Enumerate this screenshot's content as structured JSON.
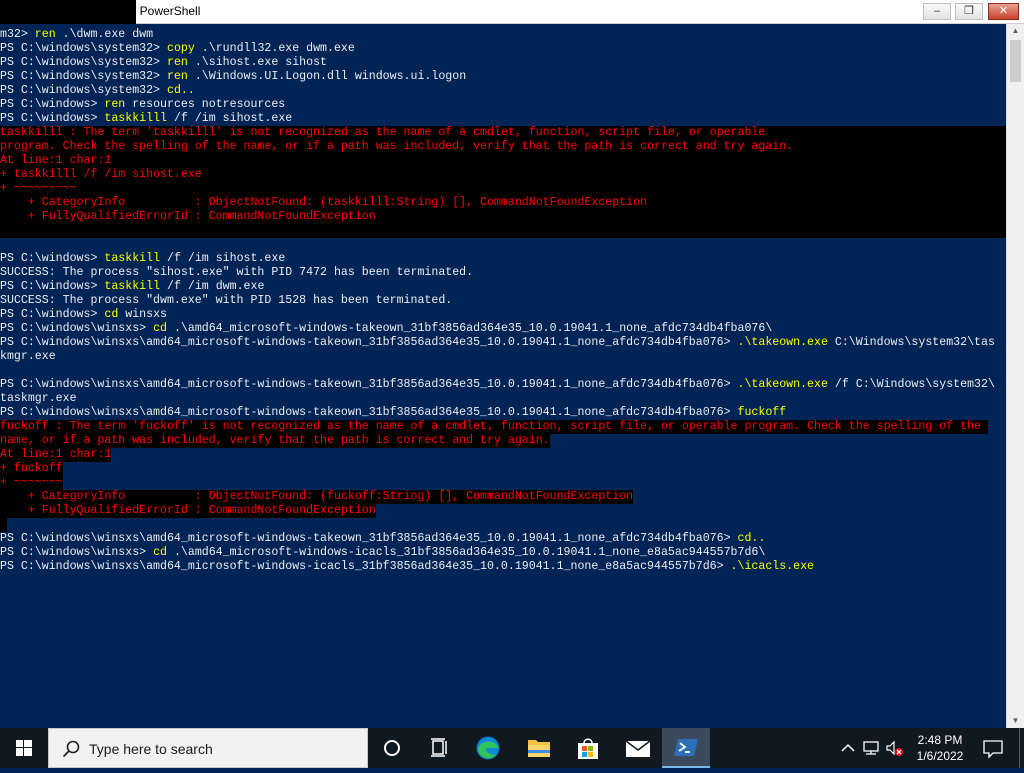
{
  "window": {
    "title": "ows PowerShell",
    "min_glyph": "‒",
    "max_glyph": "❐",
    "close_glyph": "✕"
  },
  "colors": {
    "console_bg": "#012456",
    "console_fg": "#eeedf0",
    "command_fg": "#ffff00",
    "error_fg": "#ff0000",
    "error_bg": "#000000"
  },
  "console": {
    "lines": [
      {
        "type": "mixed",
        "parts": [
          {
            "t": "m32> "
          },
          {
            "t": "ren",
            "c": 1
          },
          {
            "t": " .\\dwm.exe dwm"
          }
        ]
      },
      {
        "type": "mixed",
        "parts": [
          {
            "t": "PS C:\\windows\\system32> "
          },
          {
            "t": "copy",
            "c": 1
          },
          {
            "t": " .\\rundll32.exe dwm.exe"
          }
        ]
      },
      {
        "type": "mixed",
        "parts": [
          {
            "t": "PS C:\\windows\\system32> "
          },
          {
            "t": "ren",
            "c": 1
          },
          {
            "t": " .\\sihost.exe sihost"
          }
        ]
      },
      {
        "type": "mixed",
        "parts": [
          {
            "t": "PS C:\\windows\\system32> "
          },
          {
            "t": "ren",
            "c": 1
          },
          {
            "t": " .\\Windows.UI.Logon.dll windows.ui.logon"
          }
        ]
      },
      {
        "type": "mixed",
        "parts": [
          {
            "t": "PS C:\\windows\\system32> "
          },
          {
            "t": "cd..",
            "c": 1
          }
        ]
      },
      {
        "type": "mixed",
        "parts": [
          {
            "t": "PS C:\\windows> "
          },
          {
            "t": "ren",
            "c": 1
          },
          {
            "t": " resources notresources"
          }
        ]
      },
      {
        "type": "mixed",
        "parts": [
          {
            "t": "PS C:\\windows> "
          },
          {
            "t": "taskkilll",
            "c": 1
          },
          {
            "t": " /f /im sihost.exe"
          }
        ]
      },
      {
        "type": "err",
        "full": true,
        "text": "taskkilll : The term 'taskkilll' is not recognized as the name of a cmdlet, function, script file, or operable"
      },
      {
        "type": "err",
        "full": true,
        "text": "program. Check the spelling of the name, or if a path was included, verify that the path is correct and try again."
      },
      {
        "type": "err",
        "full": true,
        "text": "At line:1 char:1"
      },
      {
        "type": "err",
        "full": true,
        "text": "+ taskkilll /f /im sihost.exe"
      },
      {
        "type": "err",
        "full": true,
        "text": "+ ~~~~~~~~~"
      },
      {
        "type": "err",
        "full": true,
        "text": "    + CategoryInfo          : ObjectNotFound: (taskkilll:String) [], CommandNotFoundException"
      },
      {
        "type": "err",
        "full": true,
        "text": "    + FullyQualifiedErrorId : CommandNotFoundException"
      },
      {
        "type": "err",
        "full": true,
        "text": " "
      },
      {
        "type": "blank",
        "text": ""
      },
      {
        "type": "mixed",
        "parts": [
          {
            "t": "PS C:\\windows> "
          },
          {
            "t": "taskkill",
            "c": 1
          },
          {
            "t": " /f /im sihost.exe"
          }
        ]
      },
      {
        "type": "plain",
        "text": "SUCCESS: The process \"sihost.exe\" with PID 7472 has been terminated."
      },
      {
        "type": "mixed",
        "parts": [
          {
            "t": "PS C:\\windows> "
          },
          {
            "t": "taskkill",
            "c": 1
          },
          {
            "t": " /f /im dwm.exe"
          }
        ]
      },
      {
        "type": "plain",
        "text": "SUCCESS: The process \"dwm.exe\" with PID 1528 has been terminated."
      },
      {
        "type": "mixed",
        "parts": [
          {
            "t": "PS C:\\windows> "
          },
          {
            "t": "cd",
            "c": 1
          },
          {
            "t": " winsxs"
          }
        ]
      },
      {
        "type": "mixed",
        "parts": [
          {
            "t": "PS C:\\windows\\winsxs> "
          },
          {
            "t": "cd",
            "c": 1
          },
          {
            "t": " .\\amd64_microsoft-windows-takeown_31bf3856ad364e35_10.0.19041.1_none_afdc734db4fba076\\"
          }
        ]
      },
      {
        "type": "mixed",
        "parts": [
          {
            "t": "PS C:\\windows\\winsxs\\amd64_microsoft-windows-takeown_31bf3856ad364e35_10.0.19041.1_none_afdc734db4fba076> "
          },
          {
            "t": ".\\takeown.exe",
            "c": 1
          },
          {
            "t": " C:\\Windows\\system32\\tas"
          }
        ]
      },
      {
        "type": "plain",
        "text": "kmgr.exe"
      },
      {
        "type": "blank",
        "text": ""
      },
      {
        "type": "mixed",
        "parts": [
          {
            "t": "PS C:\\windows\\winsxs\\amd64_microsoft-windows-takeown_31bf3856ad364e35_10.0.19041.1_none_afdc734db4fba076> "
          },
          {
            "t": ".\\takeown.exe",
            "c": 1
          },
          {
            "t": " /f C:\\Windows\\system32\\"
          }
        ]
      },
      {
        "type": "plain",
        "text": "taskmgr.exe"
      },
      {
        "type": "mixed",
        "parts": [
          {
            "t": "PS C:\\windows\\winsxs\\amd64_microsoft-windows-takeown_31bf3856ad364e35_10.0.19041.1_none_afdc734db4fba076> "
          },
          {
            "t": "fuckoff",
            "c": 1
          }
        ]
      },
      {
        "type": "err",
        "full": false,
        "text": "fuckoff : The term 'fuckoff' is not recognized as the name of a cmdlet, function, script file, or operable program. Check the spelling of the "
      },
      {
        "type": "err",
        "full": false,
        "text": "name, or if a path was included, verify that the path is correct and try again."
      },
      {
        "type": "err",
        "full": false,
        "text": "At line:1 char:1"
      },
      {
        "type": "err",
        "full": false,
        "text": "+ fuckoff"
      },
      {
        "type": "err",
        "full": false,
        "text": "+ ~~~~~~~"
      },
      {
        "type": "err",
        "full": false,
        "text": "    + CategoryInfo          : ObjectNotFound: (fuckoff:String) [], CommandNotFoundException"
      },
      {
        "type": "err",
        "full": false,
        "text": "    + FullyQualifiedErrorId : CommandNotFoundException"
      },
      {
        "type": "err",
        "full": false,
        "text": " "
      },
      {
        "type": "mixed",
        "parts": [
          {
            "t": "PS C:\\windows\\winsxs\\amd64_microsoft-windows-takeown_31bf3856ad364e35_10.0.19041.1_none_afdc734db4fba076> "
          },
          {
            "t": "cd..",
            "c": 1
          }
        ]
      },
      {
        "type": "mixed",
        "parts": [
          {
            "t": "PS C:\\windows\\winsxs> "
          },
          {
            "t": "cd",
            "c": 1
          },
          {
            "t": " .\\amd64_microsoft-windows-icacls_31bf3856ad364e35_10.0.19041.1_none_e8a5ac944557b7d6\\"
          }
        ]
      },
      {
        "type": "mixed",
        "parts": [
          {
            "t": "PS C:\\windows\\winsxs\\amd64_microsoft-windows-icacls_31bf3856ad364e35_10.0.19041.1_none_e8a5ac944557b7d6> "
          },
          {
            "t": ".\\icacls.exe",
            "c": 1
          }
        ]
      }
    ]
  },
  "taskbar": {
    "search_placeholder": "Type here to search",
    "time": "2:48 PM",
    "date": "1/6/2022",
    "icons": [
      "windows-start-icon",
      "search-icon",
      "cortana-icon",
      "task-view-icon",
      "edge-icon",
      "file-explorer-icon",
      "store-icon",
      "mail-icon",
      "powershell-icon"
    ],
    "tray_icons": [
      "chevron-up-icon",
      "network-icon",
      "volume-muted-icon",
      "notification-icon"
    ]
  }
}
